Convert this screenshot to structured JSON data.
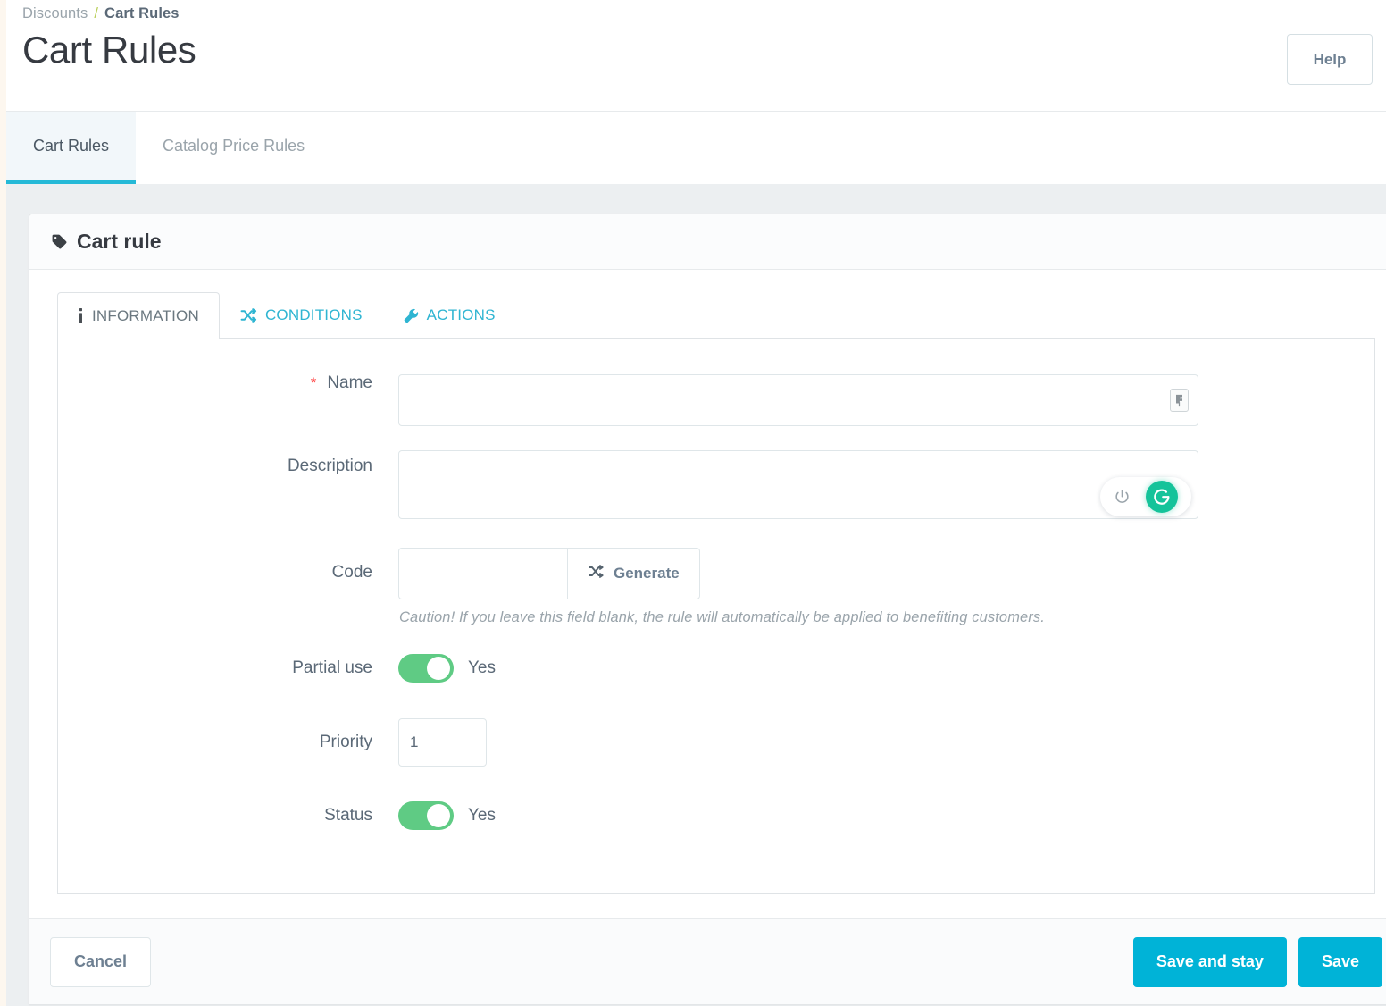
{
  "breadcrumb": {
    "parent": "Discounts",
    "separator": "/",
    "current": "Cart Rules"
  },
  "header": {
    "title": "Cart Rules",
    "help_label": "Help"
  },
  "top_tabs": [
    {
      "label": "Cart Rules",
      "active": true
    },
    {
      "label": "Catalog Price Rules",
      "active": false
    }
  ],
  "card": {
    "title": "Cart rule",
    "title_icon": "tag-icon"
  },
  "inner_tabs": [
    {
      "label": "INFORMATION",
      "icon": "info-icon",
      "active": true
    },
    {
      "label": "CONDITIONS",
      "icon": "shuffle-icon",
      "active": false
    },
    {
      "label": "ACTIONS",
      "icon": "wrench-icon",
      "active": false
    }
  ],
  "form": {
    "name": {
      "label": "Name",
      "required_marker": "*",
      "value": "",
      "placeholder": "",
      "badge_icon": "language-flag-icon"
    },
    "description": {
      "label": "Description",
      "value": "",
      "placeholder": "",
      "grammarly": {
        "power_icon": "power-icon",
        "logo_letter": "G",
        "logo_color": "#15c39a"
      }
    },
    "code": {
      "label": "Code",
      "value": "",
      "placeholder": "",
      "generate_label": "Generate",
      "generate_icon": "shuffle-icon",
      "hint": "Caution! If you leave this field blank, the rule will automatically be applied to benefiting customers."
    },
    "partial_use": {
      "label": "Partial use",
      "state_label": "Yes",
      "on": true
    },
    "priority": {
      "label": "Priority",
      "value": "1"
    },
    "status": {
      "label": "Status",
      "state_label": "Yes",
      "on": true
    }
  },
  "footer": {
    "cancel_label": "Cancel",
    "save_and_stay_label": "Save and stay",
    "save_label": "Save"
  },
  "colors": {
    "accent_cyan": "#00b3d7",
    "tab_underline": "#25b9d7",
    "toggle_green": "#5fcb84",
    "required_red": "#ff4c4c",
    "breadcrumb_sep": "#b9cf5a",
    "grammarly_green": "#15c39a"
  }
}
